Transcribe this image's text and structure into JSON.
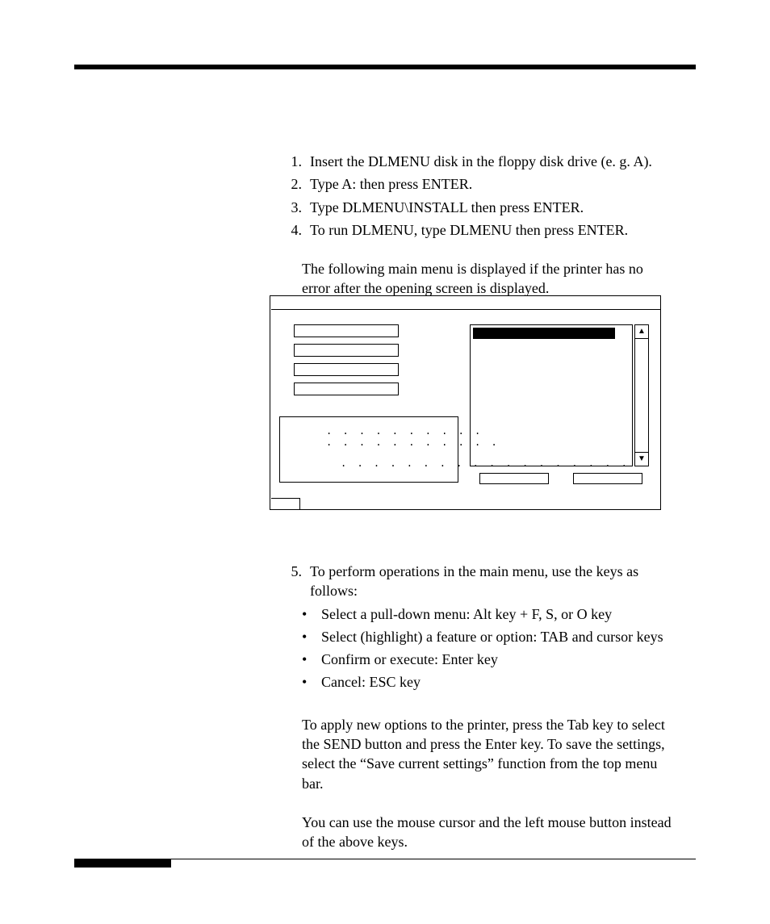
{
  "steps": {
    "s1_num": "1.",
    "s1": "Insert the DLMENU disk in the floppy disk drive (e. g. A).",
    "s2_num": "2.",
    "s2": "Type A: then press ENTER.",
    "s3_num": "3.",
    "s3": "Type DLMENU\\INSTALL then press ENTER.",
    "s4_num": "4.",
    "s4": "To run DLMENU, type DLMENU then press ENTER.",
    "after4": "The following main menu is displayed if the printer has no error after the opening screen is displayed.",
    "s5_num": "5.",
    "s5": "To perform operations in the main menu, use the keys as follows:",
    "b1": "Select a pull-down menu:  Alt key + F, S, or O key",
    "b2": "Select (highlight) a feature or option:  TAB and cursor keys",
    "b3": "Confirm or execute:  Enter key",
    "b4": "Cancel:  ESC key",
    "after5a": "To apply new options to the printer, press the Tab key to select the SEND button and press the Enter key.  To save the settings, select the “Save current settings” function from the top menu bar.",
    "after5b": "You can use the mouse cursor and the left mouse button instead of the above keys."
  },
  "figure": {
    "dots1": ". . . . . . . . . .",
    "dots2": ". . . . . . . . . . .",
    "dots3": ". . . . . . . . . . . . . . . . . .",
    "up": "▲",
    "down": "▼"
  },
  "glyphs": {
    "bullet": "•"
  }
}
